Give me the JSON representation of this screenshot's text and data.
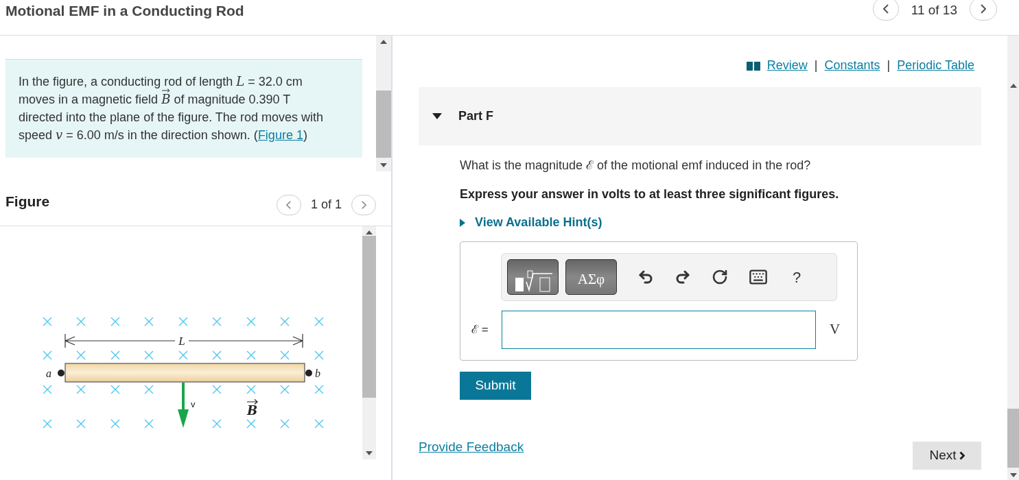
{
  "header": {
    "title": "Motional EMF in a Conducting Rod",
    "pager": "11 of 13"
  },
  "problem": {
    "text": "In the figure, a conducting rod of length *L* = 32.0 cm moves in a magnetic field",
    "vector": "B",
    "text_mid": "of magnitude 0.390 T directed into the plane of the figure. The rod moves with speed *v* = 6.00 m/s in the direction shown. (",
    "link": "Figure 1",
    "text_end": ")"
  },
  "figure": {
    "heading": "Figure",
    "pager": "1 of 1",
    "labels": {
      "length": "L",
      "end_a": "a",
      "end_b": "b",
      "velocity": "v",
      "field": "B"
    }
  },
  "resources": {
    "links": [
      "Review",
      "Constants",
      "Periodic Table"
    ],
    "separator": "|"
  },
  "part": {
    "title": "Part F",
    "expanded": true,
    "question": "What is the magnitude ℰ of the motional emf induced in the rod?",
    "instruction": "Express your answer in volts to at least three significant figures.",
    "hint": "View Available Hint(s)",
    "toolbar": {
      "symbols": "ΑΣφ",
      "help": "?"
    },
    "answer": {
      "label": "ℰ =",
      "unit": "V"
    },
    "submit": "Submit"
  },
  "footer": {
    "feedback": "Provide Feedback",
    "next": "Next"
  }
}
